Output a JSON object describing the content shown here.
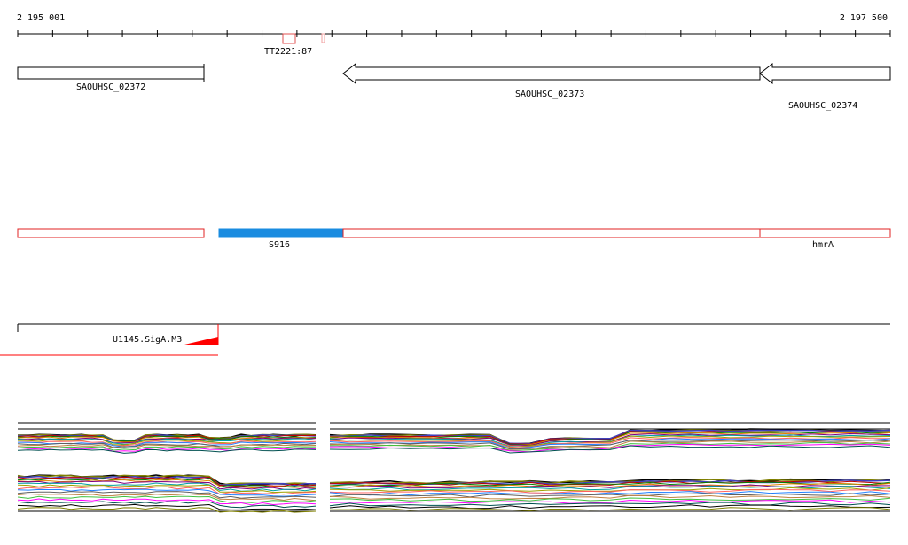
{
  "coordinates": {
    "start": "2 195 001",
    "end": "2 197 500"
  },
  "tick_count": 26,
  "marker": {
    "label": "TT2221:87"
  },
  "genes": [
    {
      "id": "SAOUHSC_02372"
    },
    {
      "id": "SAOUHSC_02373"
    },
    {
      "id": "SAOUHSC_02374"
    }
  ],
  "features": [
    {
      "label": "S916",
      "color": "#1a8ce0"
    },
    {
      "label": "hmrA"
    }
  ],
  "motif": {
    "label": "U1145.SigA.M3",
    "color": "#ff0000"
  },
  "colors": {
    "gene_outline": "#000000",
    "feature_outline": "#e02020",
    "highlight": "#1a8ce0",
    "motif": "#ff0000",
    "series": [
      "#000000",
      "#808000",
      "#4040c0",
      "#c00000",
      "#008000",
      "#e08000",
      "#800080",
      "#00a0a0",
      "#a0a000",
      "#ff6060",
      "#2080ff",
      "#606060",
      "#c08040",
      "#40c040",
      "#ff00ff",
      "#005050"
    ]
  },
  "expression_panels": {
    "left_segment": "2 195 001 – 2 195 860",
    "right_segment": "2 195 880 – 2 197 500"
  }
}
